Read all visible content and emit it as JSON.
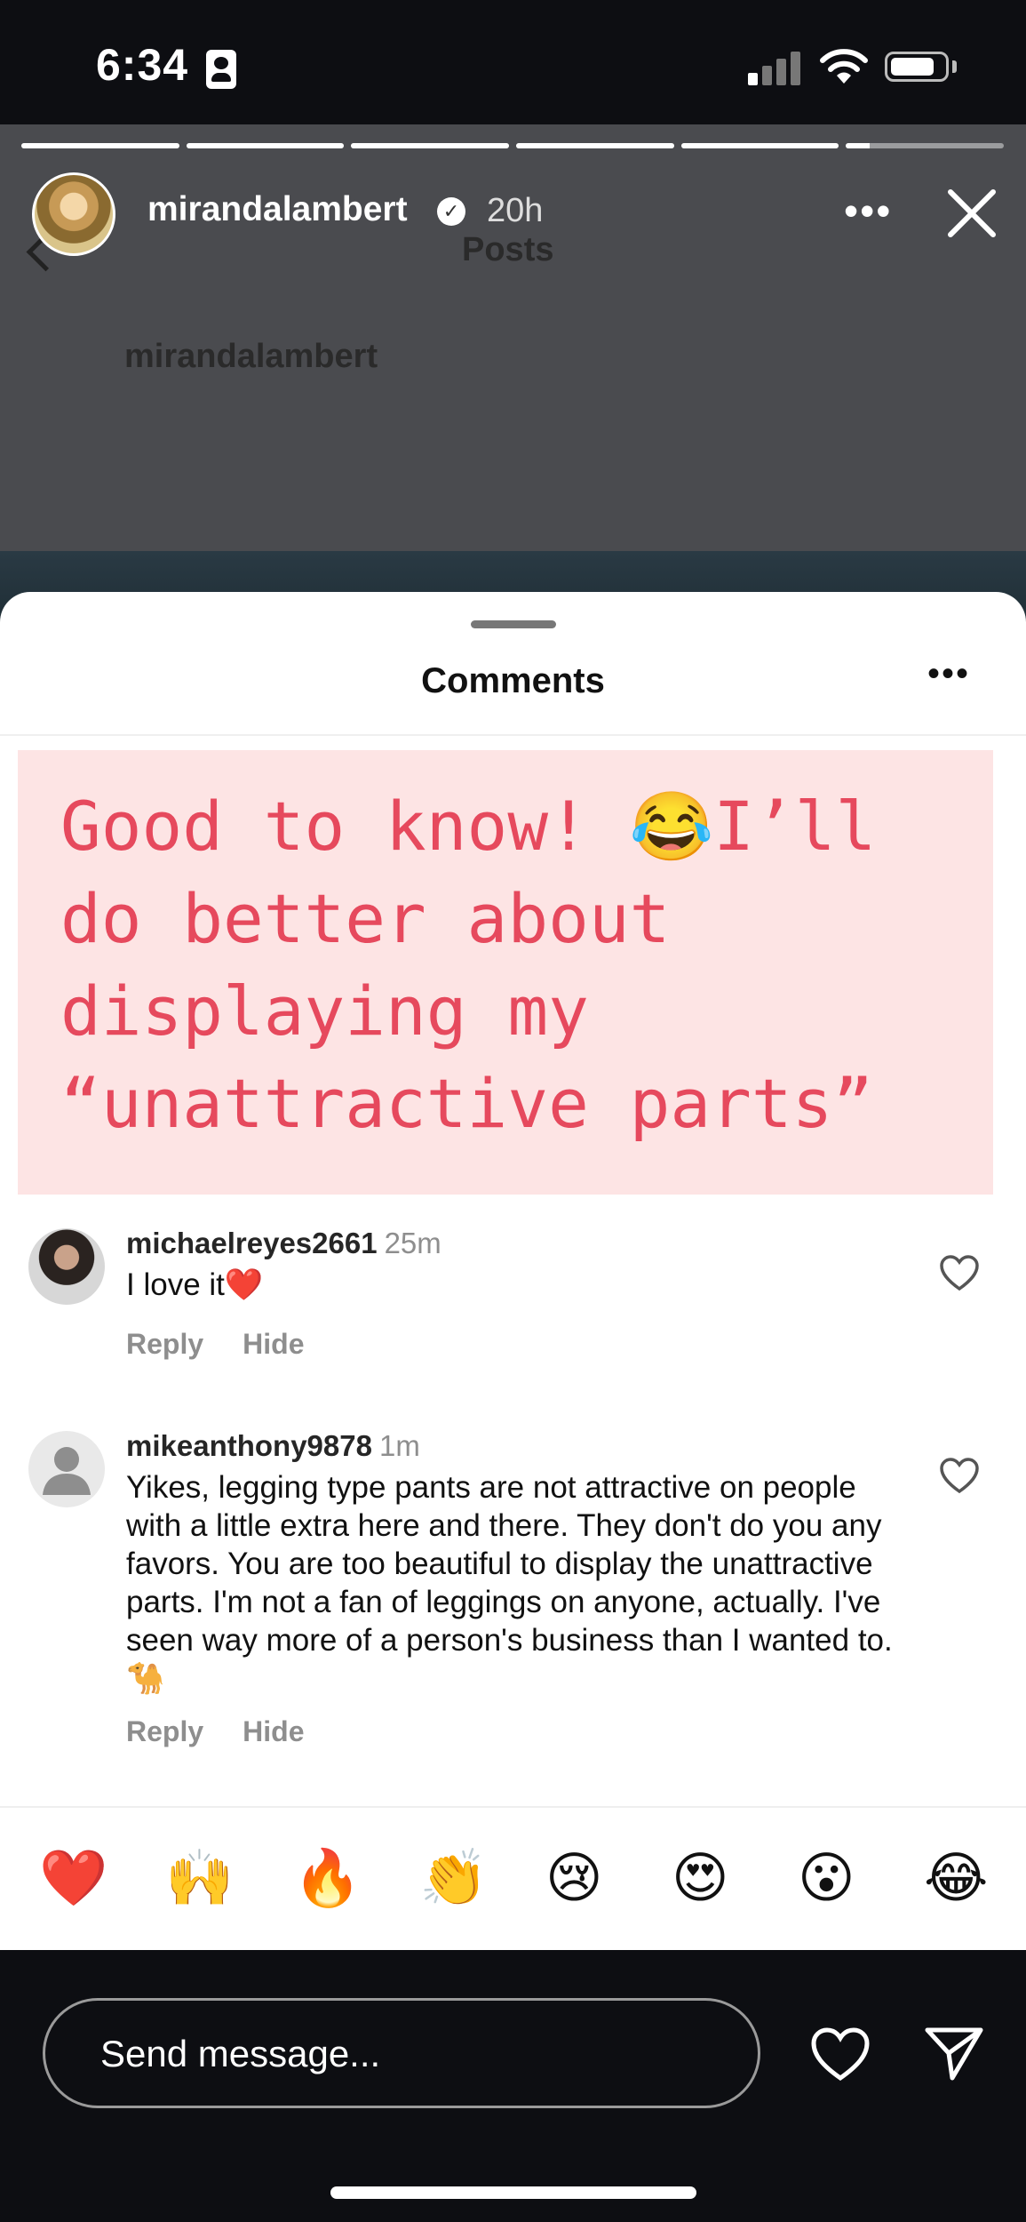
{
  "status_bar": {
    "time": "6:34"
  },
  "background_post": {
    "title": "Posts",
    "username": "mirandalambert"
  },
  "story": {
    "progress": [
      1,
      1,
      1,
      1,
      1,
      0.15
    ],
    "username": "mirandalambert",
    "time_ago": "20h"
  },
  "comments_sheet": {
    "title": "Comments",
    "post_text": "Good to know! 😂I’ll\ndo better about\ndisplaying my\n“unattractive parts”",
    "comments": [
      {
        "username": "michaelreyes2661",
        "time": "25m",
        "text": "I love it❤️",
        "reply_label": "Reply",
        "hide_label": "Hide"
      },
      {
        "username": "mikeanthony9878",
        "time": "1m",
        "text": "Yikes, legging type pants are not attractive on people with a little extra here and there. They don't do you any favors. You are too beautiful to display the unattractive parts. I'm not a fan of leggings on anyone, actually.  I've seen way more of a person's business than I wanted to. 🐪",
        "reply_label": "Reply",
        "hide_label": "Hide"
      }
    ],
    "quick_reactions": [
      "❤️",
      "🙌",
      "🔥",
      "👏",
      "😢",
      "😍",
      "😮",
      "😂"
    ]
  },
  "message_bar": {
    "placeholder": "Send message..."
  },
  "colors": {
    "accent_text": "#e6495d",
    "highlight_bg": "#fde4e4",
    "sheet_bg": "#ffffff",
    "page_bg": "#0d0e12"
  }
}
